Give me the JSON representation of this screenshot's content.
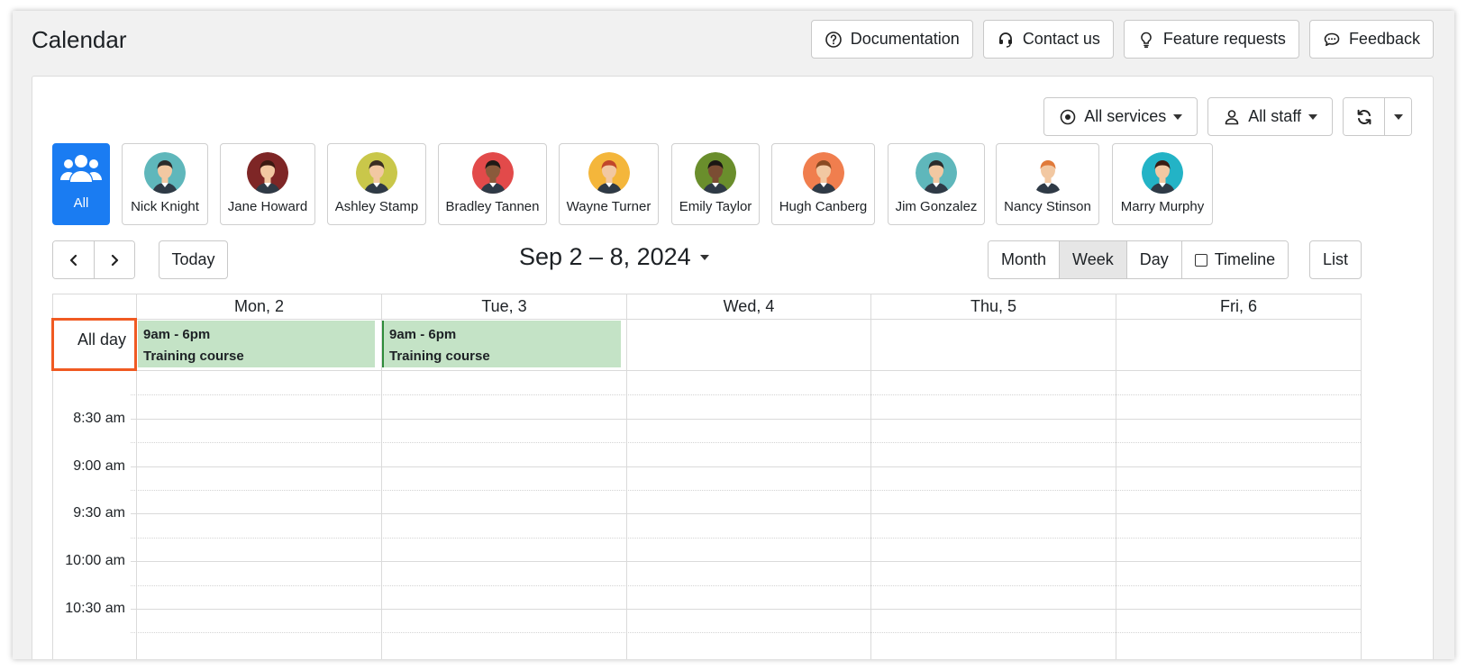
{
  "app": {
    "title": "Calendar"
  },
  "top_actions": [
    {
      "label": "Documentation",
      "icon": "question-circle-icon"
    },
    {
      "label": "Contact us",
      "icon": "headset-icon"
    },
    {
      "label": "Feature requests",
      "icon": "lightbulb-icon"
    },
    {
      "label": "Feedback",
      "icon": "chat-bubble-icon"
    }
  ],
  "filters": {
    "services": "All services",
    "staff": "All staff"
  },
  "staff": [
    {
      "name": "All",
      "selected": true,
      "icon": "users-icon"
    },
    {
      "name": "Nick Knight",
      "bg": "#5fb7bb",
      "hair": "#2b2b2b",
      "skin": "#f2c8a2"
    },
    {
      "name": "Jane Howard",
      "bg": "#7e2626",
      "hair": "#3c1a12",
      "skin": "#f2c8a2"
    },
    {
      "name": "Ashley Stamp",
      "bg": "#c9c74a",
      "hair": "#3a2e22",
      "skin": "#f2c8a2"
    },
    {
      "name": "Bradley Tannen",
      "bg": "#e24a4a",
      "hair": "#1f1a16",
      "skin": "#8a5a3b"
    },
    {
      "name": "Wayne Turner",
      "bg": "#f4b63b",
      "hair": "#c1462a",
      "skin": "#f2c8a2"
    },
    {
      "name": "Emily Taylor",
      "bg": "#6a8e2c",
      "hair": "#1b1714",
      "skin": "#7b4d33"
    },
    {
      "name": "Hugh Canberg",
      "bg": "#f07e4e",
      "hair": "#8a4a22",
      "skin": "#f2c8a2"
    },
    {
      "name": "Jim Gonzalez",
      "bg": "#5fb7bb",
      "hair": "#2b2b2b",
      "skin": "#f2c8a2"
    },
    {
      "name": "Nancy Stinson",
      "bg": "#ffffff",
      "hair": "#e07a3a",
      "skin": "#f2c8a2"
    },
    {
      "name": "Marry Murphy",
      "bg": "#23b3c6",
      "hair": "#3a1d14",
      "skin": "#f2c8a2"
    }
  ],
  "toolbar": {
    "today": "Today",
    "range": "Sep 2 – 8, 2024",
    "views": [
      "Month",
      "Week",
      "Day",
      "Timeline"
    ],
    "active_view": "Week",
    "list": "List"
  },
  "calendar": {
    "days": [
      "Mon, 2",
      "Tue, 3",
      "Wed, 4",
      "Thu, 5",
      "Fri, 6"
    ],
    "all_day_label": "All day",
    "events": [
      {
        "day": "Mon, 2",
        "time": "9am - 6pm",
        "title": "Training course"
      },
      {
        "day": "Tue, 3",
        "time": "9am - 6pm",
        "title": "Training course"
      }
    ],
    "time_slots": [
      "8:30 am",
      "9:00 am",
      "9:30 am",
      "10:00 am",
      "10:30 am"
    ]
  },
  "colors": {
    "primary": "#1a7cf2",
    "event_bg": "#c4e3c6",
    "event_border": "#2e8b3a",
    "highlight": "#f05a22"
  }
}
